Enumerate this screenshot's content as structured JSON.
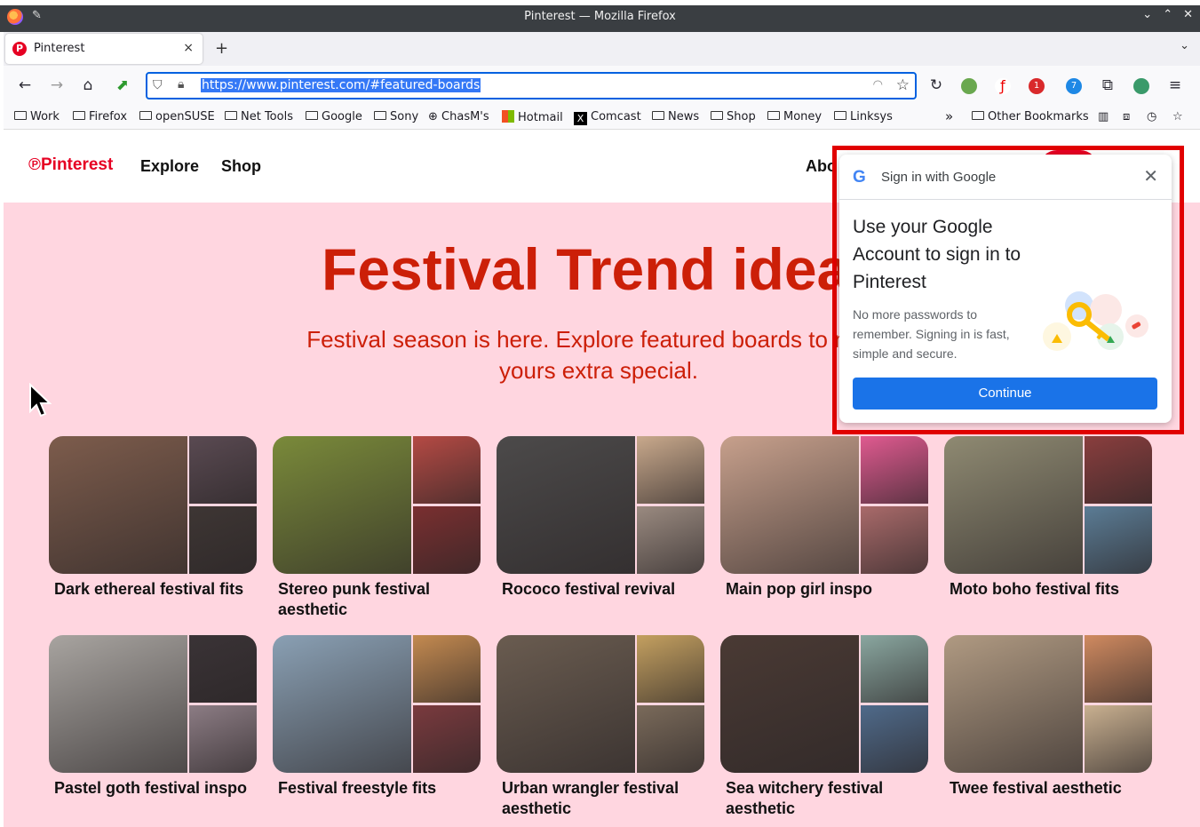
{
  "window": {
    "title": "Pinterest — Mozilla Firefox"
  },
  "tab": {
    "label": "Pinterest",
    "close": "×"
  },
  "new_tab": "+",
  "nav": {
    "url": "https://www.pinterest.com/#featured-boards",
    "ext_badges": [
      "1",
      "7"
    ]
  },
  "bookmarks": [
    "Work",
    "Firefox",
    "openSUSE",
    "Net Tools",
    "Google",
    "Sony",
    "ChasM's",
    "Hotmail",
    "Comcast",
    "News",
    "Shop",
    "Money",
    "Linksys"
  ],
  "bookmarks_overflow": "»",
  "other_bookmarks": "Other Bookmarks",
  "site": {
    "logo": "Pinterest",
    "nav": [
      "Explore",
      "Shop"
    ],
    "nav_right": "Abo",
    "hero_title": "Festival Trend ideas",
    "hero_subtitle": "Festival season is here. Explore featured boards to make yours extra special.",
    "boards": [
      {
        "title": "Dark ethereal festival fits",
        "colors": [
          "#7d5c4c",
          "#5a4a52",
          "#3e3634"
        ]
      },
      {
        "title": "Stereo punk festival aesthetic",
        "colors": [
          "#7a8a3a",
          "#b54a44",
          "#7a2f30"
        ]
      },
      {
        "title": "Rococo festival revival",
        "colors": [
          "#4c4a4a",
          "#c9a98c",
          "#9a8a80"
        ]
      },
      {
        "title": "Main pop girl inspo",
        "colors": [
          "#c7a08c",
          "#e05a90",
          "#a96a6a"
        ]
      },
      {
        "title": "Moto boho festival fits",
        "colors": [
          "#8f8a72",
          "#8a3e3e",
          "#5b7c95"
        ]
      },
      {
        "title": "Pastel goth festival inspo",
        "colors": [
          "#a8a4a0",
          "#3a3336",
          "#8c7c84"
        ]
      },
      {
        "title": "Festival freestyle fits",
        "colors": [
          "#8aa0b4",
          "#c48a50",
          "#7a3a3e"
        ]
      },
      {
        "title": "Urban wrangler festival aesthetic",
        "colors": [
          "#6a5c50",
          "#c4a060",
          "#7a6a5a"
        ]
      },
      {
        "title": "Sea witchery festival aesthetic",
        "colors": [
          "#4a3a34",
          "#8aa7a0",
          "#4f6a8a"
        ]
      },
      {
        "title": "Twee festival aesthetic",
        "colors": [
          "#b09a82",
          "#d08a60",
          "#c9b090"
        ]
      }
    ]
  },
  "google_popup": {
    "header": "Sign in with Google",
    "title": "Use your Google Account to sign in to Pinterest",
    "body": "No more passwords to remember. Signing in is fast, simple and secure.",
    "button": "Continue"
  }
}
